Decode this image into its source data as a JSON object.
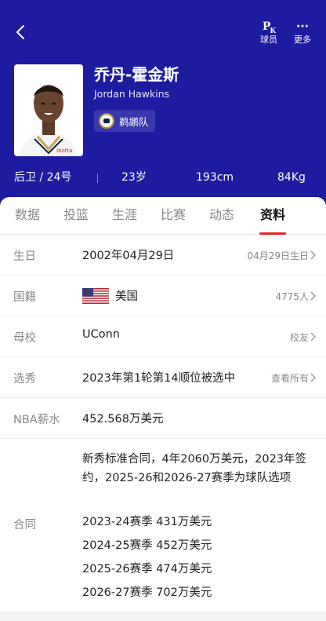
{
  "topbar": {
    "pk_glyph": "P",
    "pk_sub": "K",
    "pk_label": "球员",
    "more_glyph": "···",
    "more_label": "更多"
  },
  "player": {
    "name_cn": "乔丹-霍金斯",
    "name_en": "Jordan Hawkins",
    "team": "鹈鹕队",
    "position_number": "后卫 / 24号",
    "age": "23岁",
    "height": "193cm",
    "weight": "84Kg"
  },
  "tabs": [
    {
      "label": "数据",
      "active": false
    },
    {
      "label": "投篮",
      "active": false
    },
    {
      "label": "生涯",
      "active": false
    },
    {
      "label": "比赛",
      "active": false
    },
    {
      "label": "动态",
      "active": false
    },
    {
      "label": "资料",
      "active": true
    }
  ],
  "profile": {
    "birthday": {
      "label": "生日",
      "value": "2002年04月29日",
      "right": "04月29日生日"
    },
    "nationality": {
      "label": "国籍",
      "value": "美国",
      "right": "4775人"
    },
    "college": {
      "label": "母校",
      "value": "UConn",
      "right": "校友"
    },
    "draft": {
      "label": "选秀",
      "value": "2023年第1轮第14顺位被选中",
      "right": "查看所有"
    },
    "salary": {
      "label": "NBA薪水",
      "value": "452.568万美元"
    },
    "contract": {
      "label": "合同",
      "summary": "新秀标准合同，4年2060万美元，2023年签约，2025-26和2026-27赛季为球队选项",
      "seasons": [
        "2023-24赛季 431万美元",
        "2024-25赛季 452万美元",
        "2025-26赛季 474万美元",
        "2026-27赛季 702万美元"
      ]
    }
  },
  "colors": {
    "header_bg": "#1d1ca0",
    "tab_accent": "#e3262b"
  }
}
